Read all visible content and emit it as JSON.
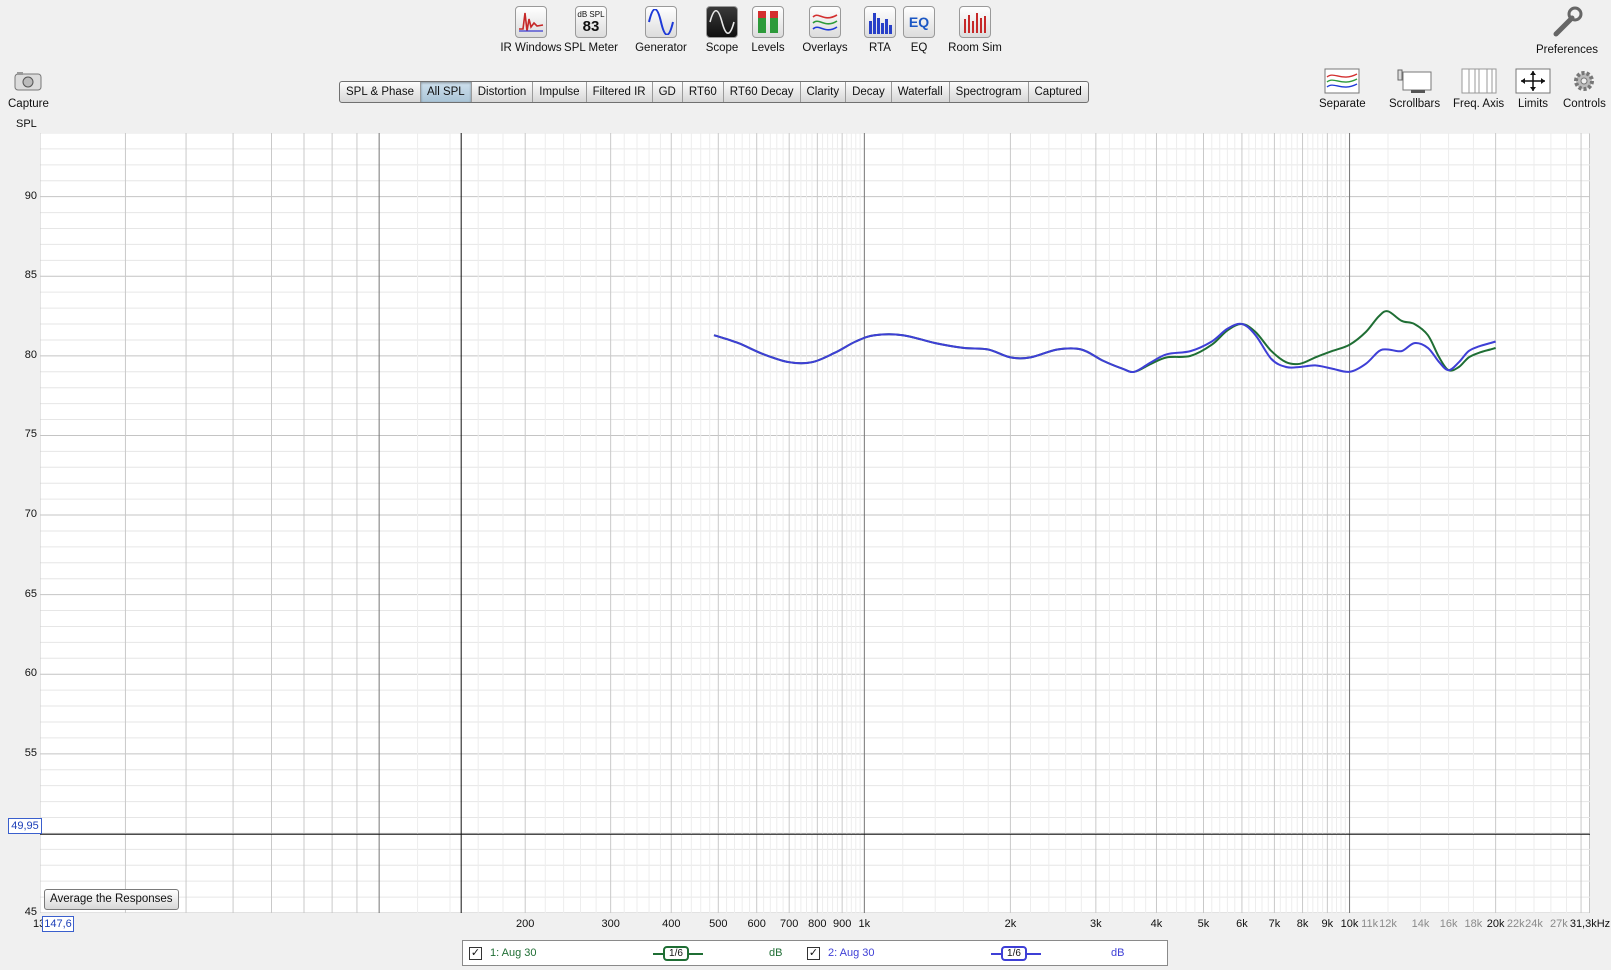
{
  "toolbar": {
    "ir_windows": "IR Windows",
    "spl_meter": "SPL Meter",
    "spl_meter_unit": "dB SPL",
    "spl_meter_value": "83",
    "generator": "Generator",
    "scope": "Scope",
    "levels": "Levels",
    "overlays": "Overlays",
    "rta": "RTA",
    "eq": "EQ",
    "eq_icon_text": "EQ",
    "room_sim": "Room Sim",
    "preferences": "Preferences"
  },
  "capture_label": "Capture",
  "tabs": [
    "SPL & Phase",
    "All SPL",
    "Distortion",
    "Impulse",
    "Filtered IR",
    "GD",
    "RT60",
    "RT60 Decay",
    "Clarity",
    "Decay",
    "Waterfall",
    "Spectrogram",
    "Captured"
  ],
  "active_tab": "All SPL",
  "right_tools": {
    "separate": "Separate",
    "scrollbars": "Scrollbars",
    "freq_axis": "Freq. Axis",
    "limits": "Limits",
    "controls": "Controls"
  },
  "colors": {
    "series1": "#1f6e34",
    "series2": "#3e3fd6",
    "cursor": "#1c3fb8"
  },
  "chart_data": {
    "type": "line",
    "ylabel": "SPL",
    "ylim": [
      45,
      94
    ],
    "xlim": [
      20,
      31300
    ],
    "x_scale": "log",
    "y_ticks": [
      "90",
      "85",
      "80",
      "75",
      "70",
      "65",
      "60",
      "55",
      "50",
      "45"
    ],
    "x_ticks": [
      {
        "f": 200,
        "label": "200"
      },
      {
        "f": 300,
        "label": "300"
      },
      {
        "f": 400,
        "label": "400"
      },
      {
        "f": 500,
        "label": "500"
      },
      {
        "f": 600,
        "label": "600"
      },
      {
        "f": 700,
        "label": "700"
      },
      {
        "f": 800,
        "label": "800"
      },
      {
        "f": 900,
        "label": "900"
      },
      {
        "f": 1000,
        "label": "1k"
      },
      {
        "f": 2000,
        "label": "2k"
      },
      {
        "f": 3000,
        "label": "3k"
      },
      {
        "f": 4000,
        "label": "4k"
      },
      {
        "f": 5000,
        "label": "5k"
      },
      {
        "f": 6000,
        "label": "6k"
      },
      {
        "f": 7000,
        "label": "7k"
      },
      {
        "f": 8000,
        "label": "8k"
      },
      {
        "f": 9000,
        "label": "9k"
      },
      {
        "f": 10000,
        "label": "10k"
      },
      {
        "f": 11000,
        "label": "11k",
        "dim": true
      },
      {
        "f": 12000,
        "label": "12k",
        "dim": true
      },
      {
        "f": 14000,
        "label": "14k",
        "dim": true
      },
      {
        "f": 16000,
        "label": "16k",
        "dim": true
      },
      {
        "f": 18000,
        "label": "18k",
        "dim": true
      },
      {
        "f": 20000,
        "label": "20k"
      },
      {
        "f": 22000,
        "label": "22k",
        "dim": true
      },
      {
        "f": 24000,
        "label": "24k",
        "dim": true
      },
      {
        "f": 27000,
        "label": "27k",
        "dim": true
      },
      {
        "f": 31300,
        "label": "31,3kHz"
      }
    ],
    "series": [
      {
        "name": "1: Aug 30",
        "x": [
          490,
          550,
          620,
          700,
          780,
          870,
          960,
          1050,
          1200,
          1400,
          1600,
          1800,
          2000,
          2200,
          2500,
          2800,
          3100,
          3400,
          3600,
          3900,
          4200,
          4700,
          5200,
          5600,
          6000,
          6400,
          6900,
          7400,
          7900,
          8500,
          9200,
          10000,
          10800,
          11500,
          12000,
          12800,
          13600,
          14500,
          15300,
          16000,
          16800,
          17600,
          18500,
          19500,
          20000
        ],
        "y": [
          81.3,
          80.8,
          80.1,
          79.6,
          79.6,
          80.2,
          80.9,
          81.3,
          81.3,
          80.8,
          80.5,
          80.4,
          79.9,
          79.9,
          80.4,
          80.4,
          79.7,
          79.2,
          79.0,
          79.5,
          79.9,
          80.0,
          80.7,
          81.6,
          82.0,
          81.5,
          80.3,
          79.6,
          79.5,
          79.9,
          80.3,
          80.7,
          81.5,
          82.5,
          82.8,
          82.2,
          82.0,
          81.3,
          79.9,
          79.1,
          79.3,
          79.9,
          80.2,
          80.4,
          80.5
        ]
      },
      {
        "name": "2: Aug 30",
        "x": [
          490,
          550,
          620,
          700,
          780,
          870,
          960,
          1050,
          1200,
          1400,
          1600,
          1800,
          2000,
          2200,
          2500,
          2800,
          3100,
          3400,
          3600,
          3900,
          4200,
          4700,
          5200,
          5600,
          6000,
          6400,
          6900,
          7400,
          7900,
          8500,
          9200,
          10000,
          10800,
          11500,
          12000,
          12800,
          13600,
          14500,
          15300,
          16000,
          16800,
          17600,
          18500,
          19500,
          20000
        ],
        "y": [
          81.3,
          80.8,
          80.1,
          79.6,
          79.6,
          80.2,
          80.9,
          81.3,
          81.3,
          80.8,
          80.5,
          80.4,
          79.9,
          79.9,
          80.4,
          80.4,
          79.7,
          79.2,
          79.0,
          79.6,
          80.1,
          80.3,
          80.9,
          81.7,
          82.0,
          81.3,
          79.8,
          79.3,
          79.3,
          79.4,
          79.2,
          79.0,
          79.5,
          80.3,
          80.4,
          80.3,
          80.8,
          80.5,
          79.6,
          79.1,
          79.6,
          80.3,
          80.6,
          80.8,
          80.9
        ]
      }
    ]
  },
  "cursor": {
    "y_value": "49,95",
    "y_level": 49.95,
    "x_value": "147,6",
    "x_freq": 147.6,
    "x_prefix": "13"
  },
  "average_button": "Average the Responses",
  "legend": {
    "item1_check": "✓",
    "item1_label": "1: Aug 30",
    "item1_smoothing": "1/6",
    "item1_unit": "dB",
    "item2_check": "✓",
    "item2_label": "2: Aug 30",
    "item2_smoothing": "1/6",
    "item2_unit": "dB"
  }
}
